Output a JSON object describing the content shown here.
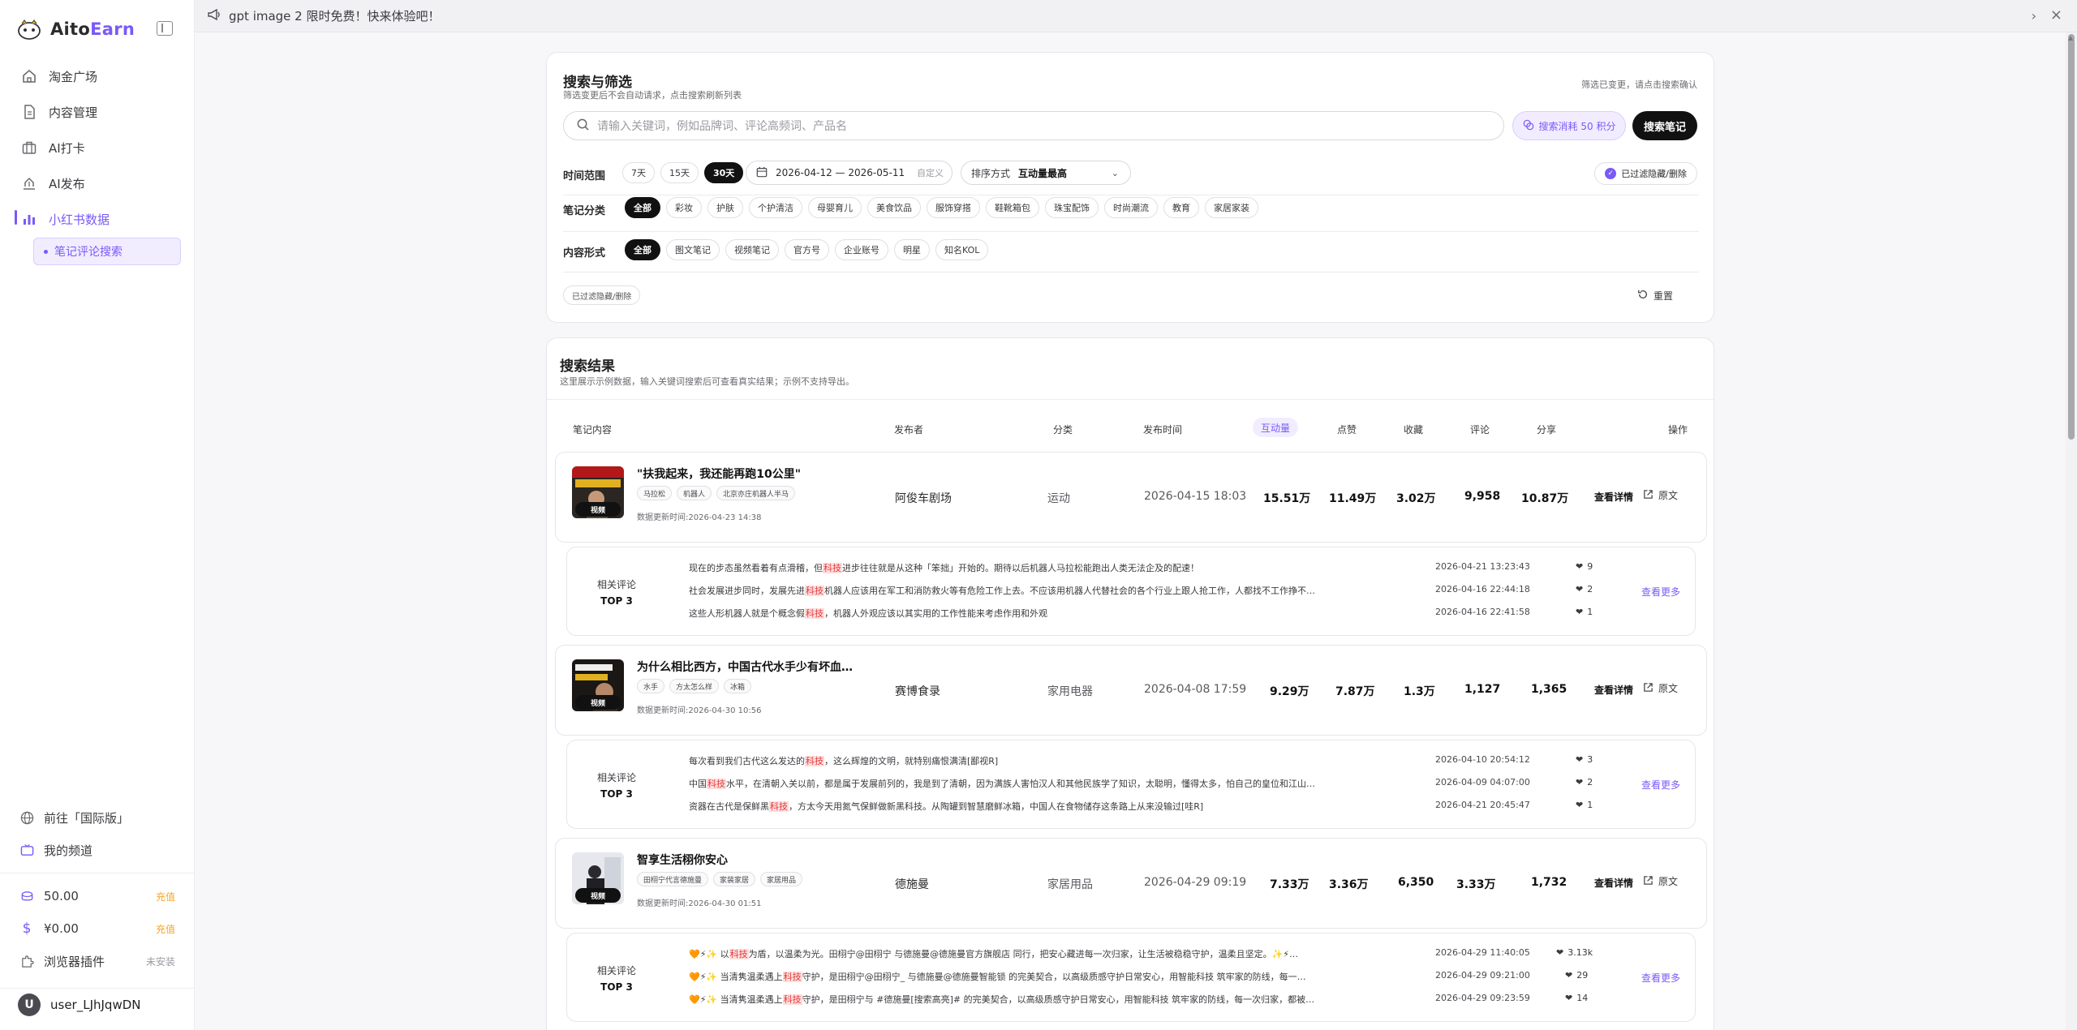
{
  "brand": {
    "name_prefix": "Aito",
    "name_suffix": "Earn"
  },
  "nav": {
    "items": [
      {
        "label": "淘金广场",
        "icon": "home-icon"
      },
      {
        "label": "内容管理",
        "icon": "document-icon"
      },
      {
        "label": "AI打卡",
        "icon": "briefcase-icon"
      },
      {
        "label": "AI发布",
        "icon": "publish-icon"
      },
      {
        "label": "小红书数据",
        "icon": "chart-icon"
      }
    ],
    "active_sub": "笔记评论搜索"
  },
  "sidebar_bottom": {
    "international": "前往「国际版」",
    "channel": "我的频道",
    "points": "50.00",
    "points_action": "充值",
    "balance": "¥0.00",
    "balance_action": "充值",
    "plugin": "浏览器插件",
    "plugin_status": "未安装",
    "user_initial": "U",
    "username": "user_LJhJqwDN"
  },
  "announcement": "gpt image 2 限时免费！快来体验吧！",
  "filter": {
    "title": "搜索与筛选",
    "subtitle": "筛选变更后不会自动请求，点击搜索刷新列表",
    "top_note": "筛选已变更，请点击搜索确认",
    "search_placeholder": "请输入关键词，例如品牌词、评论高频词、产品名",
    "cost_label": "搜索消耗 50 积分",
    "search_button": "搜索笔记",
    "time_label": "时间范围",
    "time_options": [
      "7天",
      "15天",
      "30天"
    ],
    "time_selected": "30天",
    "date_range": "2026-04-12 — 2026-05-11",
    "date_custom": "自定义",
    "sort_label": "排序方式",
    "sort_value": "互动量最高",
    "hidden_filter": "已过滤隐藏/删除",
    "category_label": "笔记分类",
    "categories": [
      "全部",
      "彩妆",
      "护肤",
      "个护清洁",
      "母婴育儿",
      "美食饮品",
      "服饰穿搭",
      "鞋靴箱包",
      "珠宝配饰",
      "时尚潮流",
      "教育",
      "家居家装"
    ],
    "category_selected": "全部",
    "format_label": "内容形式",
    "formats": [
      "全部",
      "图文笔记",
      "视频笔记",
      "官方号",
      "企业账号",
      "明星",
      "知名KOL"
    ],
    "format_selected": "全部",
    "hidden_tag": "已过滤隐藏/删除",
    "reset": "重置"
  },
  "results": {
    "title": "搜索结果",
    "subtitle": "这里展示示例数据，输入关键词搜索后可查看真实结果；示例不支持导出。",
    "headers": {
      "content": "笔记内容",
      "author": "发布者",
      "category": "分类",
      "time": "发布时间",
      "interaction": "互动量",
      "likes": "点赞",
      "saves": "收藏",
      "comments": "评论",
      "shares": "分享",
      "actions": "操作"
    },
    "detail_label": "查看详情",
    "original_label": "原文",
    "comment_label": "相关评论",
    "comment_top": "TOP 3",
    "more_label": "查看更多",
    "notes": [
      {
        "title": "\"扶我起来，我还能再跑10公里\"",
        "tags": [
          "马拉松",
          "机器人",
          "北京亦庄机器人半马"
        ],
        "badge": "视频",
        "updated": "数据更新时间:2026-04-23 14:38",
        "author": "阿俊车剧场",
        "category": "运动",
        "published": "2026-04-15 18:03",
        "interaction": "15.51万",
        "likes": "11.49万",
        "saves": "3.02万",
        "comments": "9,958",
        "shares": "10.87万",
        "comments_top": [
          {
            "pre": "现在的步态虽然看着有点滑稽，但",
            "hl": "科技",
            "post": "进步往往就是从这种「笨拙」开始的。期待以后机器人马拉松能跑出人类无法企及的配速！",
            "date": "2026-04-21 13:23:43",
            "likes": "9"
          },
          {
            "pre": "社会发展进步同时，发展先进",
            "hl": "科技",
            "post": "机器人应该用在军工和消防救火等有危险工作上去。不应该用机器人代替社会的各个行业上跟人抢工作，人都找不工作挣不…",
            "date": "2026-04-16 22:44:18",
            "likes": "2"
          },
          {
            "pre": "这些人形机器人就是个概念假",
            "hl": "科技",
            "post": "，机器人外观应该以其实用的工作性能来考虑作用和外观",
            "date": "2026-04-16 22:41:58",
            "likes": "1"
          }
        ]
      },
      {
        "title": "为什么相比西方，中国古代水手少有坏血…",
        "tags": [
          "水手",
          "方太怎么样",
          "冰箱"
        ],
        "badge": "视频",
        "updated": "数据更新时间:2026-04-30 10:56",
        "author": "赛博食录",
        "category": "家用电器",
        "published": "2026-04-08 17:59",
        "interaction": "9.29万",
        "likes": "7.87万",
        "saves": "1.3万",
        "comments": "1,127",
        "shares": "1,365",
        "comments_top": [
          {
            "pre": "每次看到我们古代这么发达的",
            "hl": "科技",
            "post": "，这么辉煌的文明，就特别痛恨满清[鄙视R]",
            "date": "2026-04-10 20:54:12",
            "likes": "3"
          },
          {
            "pre": "中国",
            "hl": "科技",
            "post": "水平，在清朝入关以前，都是属于发展前列的，我是到了清朝，因为满族人害怕汉人和其他民族学了知识，太聪明，懂得太多，怕自己的皇位和江山…",
            "date": "2026-04-09 04:07:00",
            "likes": "2"
          },
          {
            "pre": "资器在古代是保鲜黑",
            "hl": "科技",
            "post": "，方太今天用氮气保鲜做新黑科技。从陶罐到智慧磨鲜冰箱，中国人在食物储存这条路上从来没输过[哇R]",
            "date": "2026-04-21 20:45:47",
            "likes": "1"
          }
        ]
      },
      {
        "title": "智享生活栩你安心",
        "tags": [
          "田栩宁代言德施曼",
          "家装家居",
          "家居用品"
        ],
        "badge": "视频",
        "updated": "数据更新时间:2026-04-30 01:51",
        "author": "德施曼",
        "category": "家居用品",
        "published": "2026-04-29 09:19",
        "interaction": "7.33万",
        "likes": "3.36万",
        "saves": "6,350",
        "comments": "3.33万",
        "shares": "1,732",
        "comments_top": [
          {
            "pre": "🧡⚡✨ 以",
            "hl": "科技",
            "post": "为盾，以温柔为光。田栩宁@田栩宁 与德施曼@德施曼官方旗舰店 同行，把安心藏进每一次归家，让生活被稳稳守护，温柔且坚定。✨⚡…",
            "date": "2026-04-29 11:40:05",
            "likes": "3.13k"
          },
          {
            "pre": "🧡⚡✨ 当清隽温柔遇上",
            "hl": "科技",
            "post": "守护，是田栩宁@田栩宁_ 与德施曼@德施曼智能锁 的完美契合，以高级质感守护日常安心，用智能科技 筑牢家的防线，每一…",
            "date": "2026-04-29 09:21:00",
            "likes": "29"
          },
          {
            "pre": "🧡⚡✨ 当清隽温柔遇上",
            "hl": "科技",
            "post": "守护，是田栩宁与 #德施曼[搜索高亮]# 的完美契合，以高级质感守护日常安心，用智能科技 筑牢家的防线，每一次归家，都被…",
            "date": "2026-04-29 09:23:59",
            "likes": "14"
          }
        ]
      }
    ]
  },
  "colors": {
    "accent": "#7a5af8",
    "highlight": "#e03b3b",
    "dark": "#111111"
  }
}
